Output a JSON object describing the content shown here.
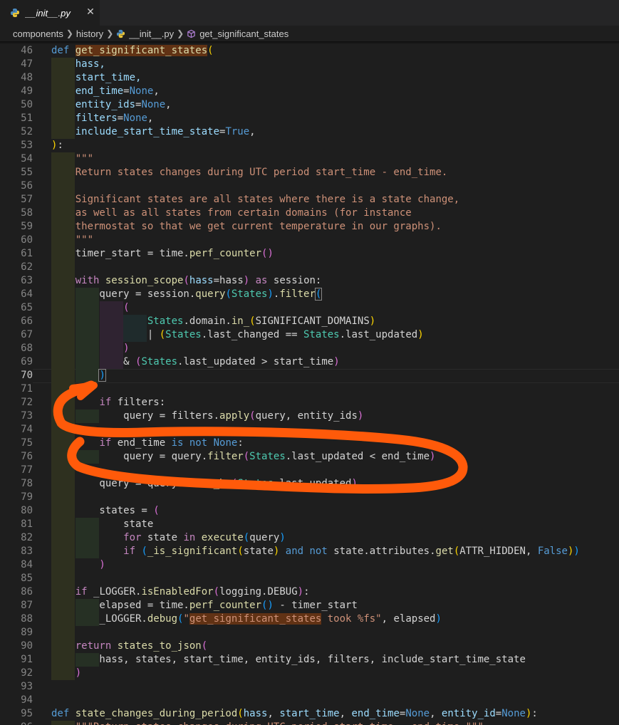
{
  "tab": {
    "title": "__init__.py",
    "close": "✕",
    "icon": "python-file-icon"
  },
  "breadcrumb": [
    "components",
    "history",
    "__init__.py",
    "get_significant_states"
  ],
  "lines": [
    {
      "n": 46,
      "g": 0,
      "t": [
        [
          "def ",
          "k-def"
        ],
        [
          "get_significant_states",
          "fn hl"
        ],
        [
          "(",
          "b1"
        ]
      ]
    },
    {
      "n": 47,
      "g": 1,
      "t": [
        [
          "    hass,",
          "par"
        ]
      ]
    },
    {
      "n": 48,
      "g": 1,
      "t": [
        [
          "    start_time,",
          "par"
        ]
      ]
    },
    {
      "n": 49,
      "g": 1,
      "t": [
        [
          "    end_time",
          "par"
        ],
        [
          "=",
          ""
        ],
        [
          "None",
          "cst"
        ],
        [
          ",",
          ""
        ]
      ]
    },
    {
      "n": 50,
      "g": 1,
      "t": [
        [
          "    entity_ids",
          "par"
        ],
        [
          "=",
          ""
        ],
        [
          "None",
          "cst"
        ],
        [
          ",",
          ""
        ]
      ]
    },
    {
      "n": 51,
      "g": 1,
      "t": [
        [
          "    filters",
          "par"
        ],
        [
          "=",
          ""
        ],
        [
          "None",
          "cst"
        ],
        [
          ",",
          ""
        ]
      ]
    },
    {
      "n": 52,
      "g": 1,
      "t": [
        [
          "    include_start_time_state",
          "par"
        ],
        [
          "=",
          ""
        ],
        [
          "True",
          "cst"
        ],
        [
          ",",
          ""
        ]
      ]
    },
    {
      "n": 53,
      "g": 0,
      "t": [
        [
          ")",
          "b1"
        ],
        [
          ":",
          ""
        ]
      ]
    },
    {
      "n": 54,
      "g": 1,
      "t": [
        [
          "    \"\"\"",
          "str"
        ]
      ]
    },
    {
      "n": 55,
      "g": 1,
      "t": [
        [
          "    Return states changes during UTC period start_time - end_time.",
          "str"
        ]
      ]
    },
    {
      "n": 56,
      "g": 1,
      "t": []
    },
    {
      "n": 57,
      "g": 1,
      "t": [
        [
          "    Significant states are all states where there is a state change,",
          "str"
        ]
      ]
    },
    {
      "n": 58,
      "g": 1,
      "t": [
        [
          "    as well as all states from certain domains (for instance",
          "str"
        ]
      ]
    },
    {
      "n": 59,
      "g": 1,
      "t": [
        [
          "    thermostat so that we get current temperature in our graphs).",
          "str"
        ]
      ]
    },
    {
      "n": 60,
      "g": 1,
      "t": [
        [
          "    \"\"\"",
          "str"
        ]
      ]
    },
    {
      "n": 61,
      "g": 1,
      "t": [
        [
          "    timer_start = time.",
          ""
        ],
        [
          "perf_counter",
          "fn"
        ],
        [
          "(",
          "b2"
        ],
        [
          ")",
          "b2"
        ]
      ]
    },
    {
      "n": 62,
      "g": 1,
      "t": []
    },
    {
      "n": 63,
      "g": 1,
      "t": [
        [
          "    ",
          ""
        ],
        [
          "with ",
          "k-ctl"
        ],
        [
          "session_scope",
          "fn"
        ],
        [
          "(",
          "b2"
        ],
        [
          "hass",
          "par"
        ],
        [
          "=hass",
          ""
        ],
        [
          ")",
          "b2"
        ],
        [
          " as ",
          "k-ctl"
        ],
        [
          "session:",
          ""
        ]
      ]
    },
    {
      "n": 64,
      "g": 2,
      "t": [
        [
          "        query = session.",
          ""
        ],
        [
          "query",
          "fn"
        ],
        [
          "(",
          "b3"
        ],
        [
          "States",
          "cls"
        ],
        [
          ")",
          "b3"
        ],
        [
          ".",
          ""
        ],
        [
          "filter",
          "fn"
        ],
        [
          "(",
          "b3 bracket-box"
        ]
      ]
    },
    {
      "n": 65,
      "g": 3,
      "t": [
        [
          "            (",
          "b2"
        ]
      ]
    },
    {
      "n": 66,
      "g": 4,
      "t": [
        [
          "                ",
          ""
        ],
        [
          "States",
          "cls"
        ],
        [
          ".domain.",
          ""
        ],
        [
          "in_",
          "fn"
        ],
        [
          "(",
          "b1"
        ],
        [
          "SIGNIFICANT_DOMAINS",
          ""
        ],
        [
          ")",
          "b1"
        ]
      ]
    },
    {
      "n": 67,
      "g": 4,
      "t": [
        [
          "                | ",
          ""
        ],
        [
          "(",
          "b1"
        ],
        [
          "States",
          "cls"
        ],
        [
          ".last_changed == ",
          ""
        ],
        [
          "States",
          "cls"
        ],
        [
          ".last_updated",
          ""
        ],
        [
          ")",
          "b1"
        ]
      ]
    },
    {
      "n": 68,
      "g": 3,
      "t": [
        [
          "            )",
          "b2"
        ]
      ]
    },
    {
      "n": 69,
      "g": 3,
      "t": [
        [
          "            & ",
          ""
        ],
        [
          "(",
          "b2"
        ],
        [
          "States",
          "cls"
        ],
        [
          ".last_updated > start_time",
          ""
        ],
        [
          ")",
          "b2"
        ]
      ]
    },
    {
      "n": 70,
      "g": 2,
      "t": [
        [
          "        ",
          ""
        ],
        [
          ")",
          "b3 bracket-box"
        ]
      ]
    },
    {
      "n": 71,
      "g": 1,
      "t": []
    },
    {
      "n": 72,
      "g": 1,
      "t": [
        [
          "        ",
          ""
        ],
        [
          "if ",
          "k-ctl"
        ],
        [
          "filters:",
          ""
        ]
      ]
    },
    {
      "n": 73,
      "g": 2,
      "t": [
        [
          "            query = filters.",
          ""
        ],
        [
          "apply",
          "fn"
        ],
        [
          "(",
          "b2"
        ],
        [
          "query, entity_ids",
          ""
        ],
        [
          ")",
          "b2"
        ]
      ]
    },
    {
      "n": 74,
      "g": 1,
      "t": []
    },
    {
      "n": 75,
      "g": 1,
      "t": [
        [
          "        ",
          ""
        ],
        [
          "if ",
          "k-ctl"
        ],
        [
          "end_time ",
          ""
        ],
        [
          "is not ",
          "k-def"
        ],
        [
          "None",
          "cst"
        ],
        [
          ":",
          ""
        ]
      ]
    },
    {
      "n": 76,
      "g": 2,
      "t": [
        [
          "            query = query.",
          ""
        ],
        [
          "filter",
          "fn"
        ],
        [
          "(",
          "b2"
        ],
        [
          "States",
          "cls"
        ],
        [
          ".last_updated < end_time",
          ""
        ],
        [
          ")",
          "b2"
        ]
      ]
    },
    {
      "n": 77,
      "g": 1,
      "t": []
    },
    {
      "n": 78,
      "g": 1,
      "t": [
        [
          "        query = query.",
          ""
        ],
        [
          "order_by",
          "fn"
        ],
        [
          "(",
          "b2"
        ],
        [
          "States",
          "cls"
        ],
        [
          ".last_updated",
          ""
        ],
        [
          ")",
          "b2"
        ]
      ]
    },
    {
      "n": 79,
      "g": 1,
      "t": []
    },
    {
      "n": 80,
      "g": 1,
      "t": [
        [
          "        states = ",
          ""
        ],
        [
          "(",
          "b2"
        ]
      ]
    },
    {
      "n": 81,
      "g": 2,
      "t": [
        [
          "            state",
          ""
        ]
      ]
    },
    {
      "n": 82,
      "g": 2,
      "t": [
        [
          "            ",
          ""
        ],
        [
          "for ",
          "k-ctl"
        ],
        [
          "state ",
          ""
        ],
        [
          "in ",
          "k-ctl"
        ],
        [
          "execute",
          "fn"
        ],
        [
          "(",
          "b3"
        ],
        [
          "query",
          ""
        ],
        [
          ")",
          "b3"
        ]
      ]
    },
    {
      "n": 83,
      "g": 2,
      "t": [
        [
          "            ",
          ""
        ],
        [
          "if ",
          "k-ctl"
        ],
        [
          "(",
          "b3"
        ],
        [
          "_is_significant",
          "fn"
        ],
        [
          "(",
          "b1"
        ],
        [
          "state",
          ""
        ],
        [
          ")",
          "b1"
        ],
        [
          " and not ",
          "k-def"
        ],
        [
          "state.attributes.",
          ""
        ],
        [
          "get",
          "fn"
        ],
        [
          "(",
          "b1"
        ],
        [
          "ATTR_HIDDEN, ",
          ""
        ],
        [
          "False",
          "cst"
        ],
        [
          ")",
          "b1"
        ],
        [
          ")",
          "b3"
        ]
      ]
    },
    {
      "n": 84,
      "g": 1,
      "t": [
        [
          "        )",
          "b2"
        ]
      ]
    },
    {
      "n": 85,
      "g": 1,
      "t": []
    },
    {
      "n": 86,
      "g": 1,
      "t": [
        [
          "    ",
          ""
        ],
        [
          "if ",
          "k-ctl"
        ],
        [
          "_LOGGER.",
          ""
        ],
        [
          "isEnabledFor",
          "fn"
        ],
        [
          "(",
          "b2"
        ],
        [
          "logging.DEBUG",
          ""
        ],
        [
          ")",
          "b2"
        ],
        [
          ":",
          ""
        ]
      ]
    },
    {
      "n": 87,
      "g": 2,
      "t": [
        [
          "        elapsed = time.",
          ""
        ],
        [
          "perf_counter",
          "fn"
        ],
        [
          "(",
          "b3"
        ],
        [
          ")",
          "b3"
        ],
        [
          " - timer_start",
          ""
        ]
      ]
    },
    {
      "n": 88,
      "g": 2,
      "t": [
        [
          "        _LOGGER.",
          ""
        ],
        [
          "debug",
          "fn"
        ],
        [
          "(",
          "b3"
        ],
        [
          "\"",
          "str"
        ],
        [
          "get_significant_states",
          "str hl"
        ],
        [
          " took %fs\"",
          "str"
        ],
        [
          ", elapsed",
          ""
        ],
        [
          ")",
          "b3"
        ]
      ]
    },
    {
      "n": 89,
      "g": 1,
      "t": []
    },
    {
      "n": 90,
      "g": 1,
      "t": [
        [
          "    ",
          ""
        ],
        [
          "return ",
          "k-ctl"
        ],
        [
          "states_to_json",
          "fn"
        ],
        [
          "(",
          "b2"
        ]
      ]
    },
    {
      "n": 91,
      "g": 2,
      "t": [
        [
          "        hass, states, start_time, entity_ids, filters, include_start_time_state",
          ""
        ]
      ]
    },
    {
      "n": 92,
      "g": 1,
      "t": [
        [
          "    )",
          "b2"
        ]
      ]
    },
    {
      "n": 93,
      "g": 0,
      "t": []
    },
    {
      "n": 94,
      "g": 0,
      "t": []
    },
    {
      "n": 95,
      "g": 0,
      "t": [
        [
          "def ",
          "k-def"
        ],
        [
          "state_changes_during_period",
          "fn"
        ],
        [
          "(",
          "b1"
        ],
        [
          "hass",
          "par"
        ],
        [
          ", ",
          ""
        ],
        [
          "start_time",
          "par"
        ],
        [
          ", ",
          ""
        ],
        [
          "end_time",
          "par"
        ],
        [
          "=",
          ""
        ],
        [
          "None",
          "cst"
        ],
        [
          ", ",
          ""
        ],
        [
          "entity_id",
          "par"
        ],
        [
          "=",
          ""
        ],
        [
          "None",
          "cst"
        ],
        [
          ")",
          "b1"
        ],
        [
          ":",
          ""
        ]
      ]
    },
    {
      "n": 96,
      "g": 1,
      "t": [
        [
          "    \"\"\"Return states changes during UTC period start_time - end_time.\"\"\"",
          "str"
        ]
      ]
    }
  ]
}
